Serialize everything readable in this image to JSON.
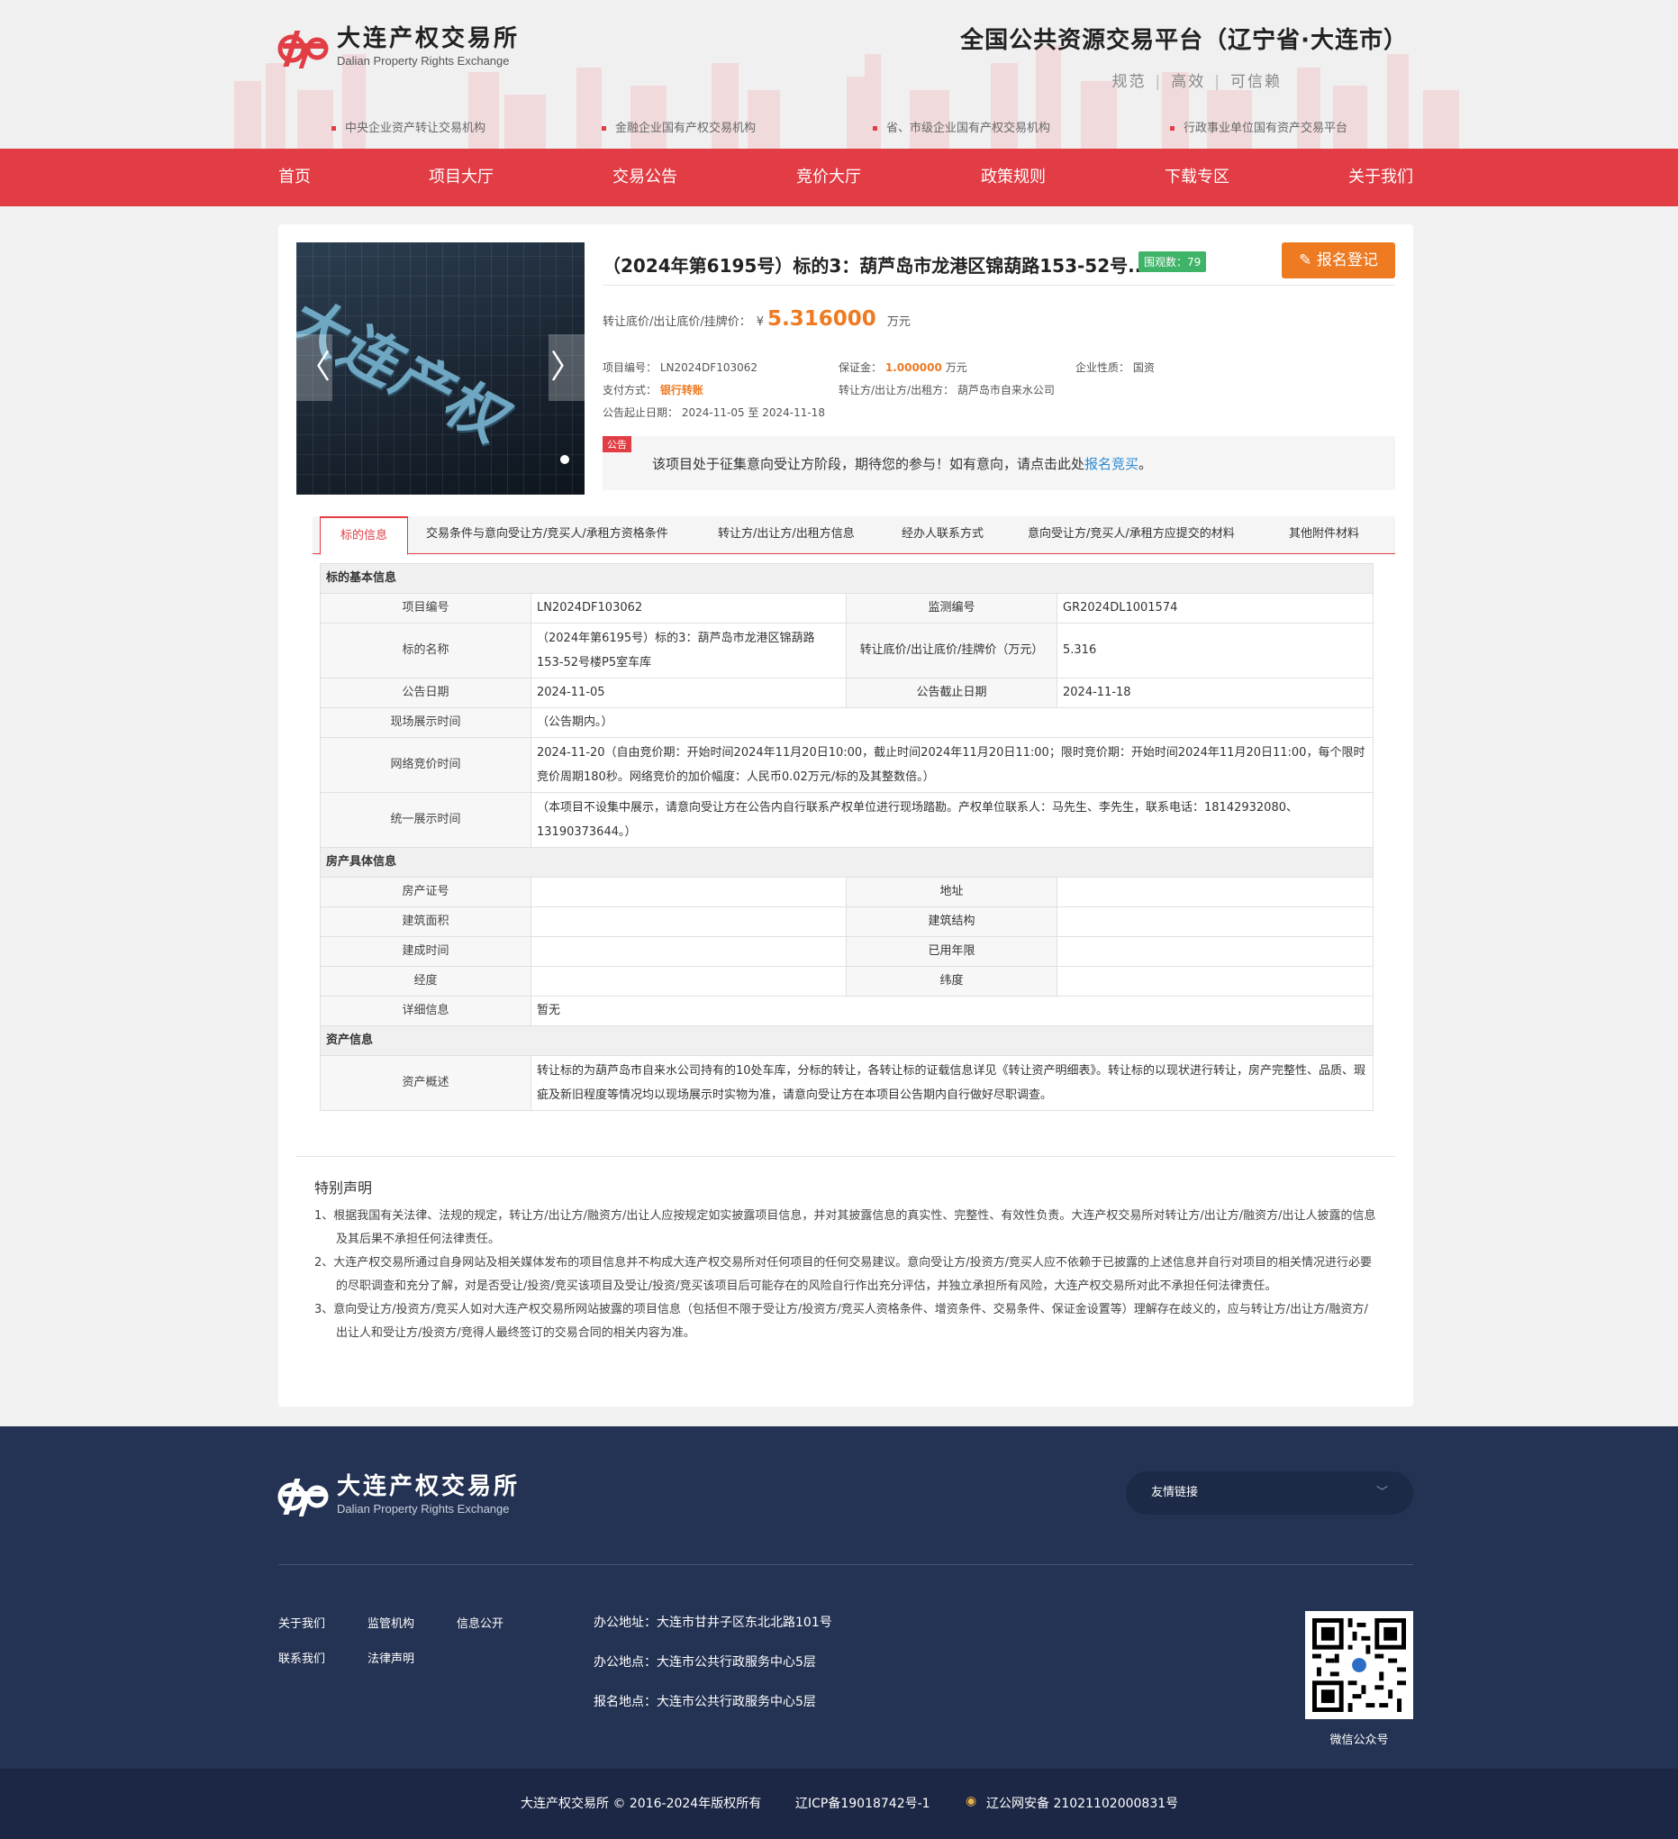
{
  "header": {
    "logo_cn": "大连产权交易所",
    "logo_en": "Dalian Property Rights Exchange",
    "platform_title": "全国公共资源交易平台（辽宁省·大连市）",
    "tags": [
      "规范",
      "高效",
      "可信赖"
    ],
    "links": [
      "中央企业资产转让交易机构",
      "金融企业国有产权交易机构",
      "省、市级企业国有产权交易机构",
      "行政事业单位国有资产交易平台"
    ]
  },
  "nav": [
    "首页",
    "项目大厅",
    "交易公告",
    "竞价大厅",
    "政策规则",
    "下载专区",
    "关于我们"
  ],
  "slider": {
    "sign_text": "大连产权",
    "prev": "〈",
    "next": "〉"
  },
  "project": {
    "title": "（2024年第6195号）标的3：葫芦岛市龙港区锦葫路153-52号...",
    "views": "围观数：79",
    "signup_label": "报名登记",
    "price_label": "转让底价/出让底价/挂牌价：",
    "currency": "¥",
    "price": "5.316000",
    "price_unit": "万元",
    "code_label": "项目编号：",
    "code": "LN2024DF103062",
    "deposit_label": "保证金：",
    "deposit": "1.000000",
    "deposit_unit": "万元",
    "nature_label": "企业性质：",
    "nature": "国资",
    "pay_label": "支付方式：",
    "pay": "银行转账",
    "seller_label": "转让方/出让方/出租方：",
    "seller": "葫芦岛市自来水公司",
    "date_label": "公告起止日期：",
    "date": "2024-11-05 至 2024-11-18"
  },
  "notice": {
    "tag": "公告",
    "text": "该项目处于征集意向受让方阶段，期待您的参与！如有意向，请点击此处",
    "link": "报名竞买",
    "end": "。"
  },
  "tabs": [
    "标的信息",
    "交易条件与意向受让方/竞买人/承租方资格条件",
    "转让方/出让方/出租方信息",
    "经办人联系方式",
    "意向受让方/竞买人/承租方应提交的材料",
    "其他附件材料"
  ],
  "table": {
    "sec1": "标的基本信息",
    "code_label": "项目编号",
    "code": "LN2024DF103062",
    "monitor_label": "监测编号",
    "monitor": "GR2024DL1001574",
    "name_label": "标的名称",
    "name": "（2024年第6195号）标的3：葫芦岛市龙港区锦葫路153-52号楼P5室车库",
    "price_label": "转让底价/出让底价/挂牌价（万元）",
    "price": "5.316",
    "date_label": "公告日期",
    "date": "2024-11-05",
    "end_label": "公告截止日期",
    "end": "2024-11-18",
    "site_label": "现场展示时间",
    "site": "（公告期内。）",
    "bid_label": "网络竞价时间",
    "bid": "2024-11-20（自由竞价期：开始时间2024年11月20日10:00，截止时间2024年11月20日11:00；限时竞价期：开始时间2024年11月20日11:00，每个限时竞价周期180秒。网络竞价的加价幅度：人民币0.02万元/标的及其整数倍。）",
    "unified_label": "统一展示时间",
    "unified": "（本项目不设集中展示，请意向受让方在公告内自行联系产权单位进行现场踏勘。产权单位联系人：马先生、李先生，联系电话：18142932080、13190373644。）",
    "sec2": "房产具体信息",
    "cert_label": "房产证号",
    "addr_label": "地址",
    "area_label": "建筑面积",
    "struct_label": "建筑结构",
    "built_label": "建成时间",
    "used_label": "已用年限",
    "lng_label": "经度",
    "lat_label": "纬度",
    "detail_label": "详细信息",
    "detail": "暂无",
    "sec3": "资产信息",
    "asset_label": "资产概述",
    "asset": "转让标的为葫芦岛市自来水公司持有的10处车库，分标的转让，各转让标的证载信息详见《转让资产明细表》。转让标的以现状进行转让，房产完整性、品质、瑕疵及新旧程度等情况均以现场展示时实物为准，请意向受让方在本项目公告期内自行做好尽职调查。"
  },
  "statement": {
    "title": "特别声明",
    "items": [
      "1、根据我国有关法律、法规的规定，转让方/出让方/融资方/出让人应按规定如实披露项目信息，并对其披露信息的真实性、完整性、有效性负责。大连产权交易所对转让方/出让方/融资方/出让人披露的信息及其后果不承担任何法律责任。",
      "2、大连产权交易所通过自身网站及相关媒体发布的项目信息并不构成大连产权交易所对任何项目的任何交易建议。意向受让方/投资方/竞买人应不依赖于已披露的上述信息并自行对项目的相关情况进行必要的尽职调查和充分了解，对是否受让/投资/竞买该项目及受让/投资/竞买该项目后可能存在的风险自行作出充分评估，并独立承担所有风险，大连产权交易所对此不承担任何法律责任。",
      "3、意向受让方/投资方/竞买人如对大连产权交易所网站披露的项目信息（包括但不限于受让方/投资方/竞买人资格条件、增资条件、交易条件、保证金设置等）理解存在歧义的，应与转让方/出让方/融资方/出让人和受让方/投资方/竞得人最终签订的交易合同的相关内容为准。"
    ]
  },
  "footer": {
    "logo_cn": "大连产权交易所",
    "logo_en": "Dalian Property Rights Exchange",
    "friend_links": "友情链接",
    "links": [
      "关于我们",
      "监管机构",
      "信息公开",
      "联系我们",
      "法律声明"
    ],
    "addr1": "办公地址：大连市甘井子区东北北路101号",
    "addr2": "办公地点：大连市公共行政服务中心5层",
    "addr3": "报名地点：大连市公共行政服务中心5层",
    "qr_label": "微信公众号",
    "copyright": "大连产权交易所 © 2016-2024年版权所有",
    "icp": "辽ICP备19018742号-1",
    "police": "辽公网安备 21021102000831号"
  }
}
